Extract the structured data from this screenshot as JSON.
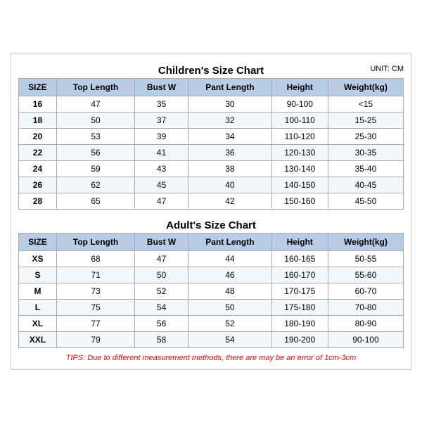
{
  "children_title": "Children's Size Chart",
  "adult_title": "Adult's Size Chart",
  "unit": "UNIT: CM",
  "children_headers": [
    "SIZE",
    "Top Length",
    "Bust W",
    "Pant Length",
    "Height",
    "Weight(kg)"
  ],
  "children_rows": [
    [
      "16",
      "47",
      "35",
      "30",
      "90-100",
      "<15"
    ],
    [
      "18",
      "50",
      "37",
      "32",
      "100-110",
      "15-25"
    ],
    [
      "20",
      "53",
      "39",
      "34",
      "110-120",
      "25-30"
    ],
    [
      "22",
      "56",
      "41",
      "36",
      "120-130",
      "30-35"
    ],
    [
      "24",
      "59",
      "43",
      "38",
      "130-140",
      "35-40"
    ],
    [
      "26",
      "62",
      "45",
      "40",
      "140-150",
      "40-45"
    ],
    [
      "28",
      "65",
      "47",
      "42",
      "150-160",
      "45-50"
    ]
  ],
  "adult_headers": [
    "SIZE",
    "Top Length",
    "Bust W",
    "Pant Length",
    "Height",
    "Weight(kg)"
  ],
  "adult_rows": [
    [
      "XS",
      "68",
      "47",
      "44",
      "160-165",
      "50-55"
    ],
    [
      "S",
      "71",
      "50",
      "46",
      "160-170",
      "55-60"
    ],
    [
      "M",
      "73",
      "52",
      "48",
      "170-175",
      "60-70"
    ],
    [
      "L",
      "75",
      "54",
      "50",
      "175-180",
      "70-80"
    ],
    [
      "XL",
      "77",
      "56",
      "52",
      "180-190",
      "80-90"
    ],
    [
      "XXL",
      "79",
      "58",
      "54",
      "190-200",
      "90-100"
    ]
  ],
  "tips": "TIPS: Due to different measurement methods, there are may be an error of 1cm-3cm"
}
